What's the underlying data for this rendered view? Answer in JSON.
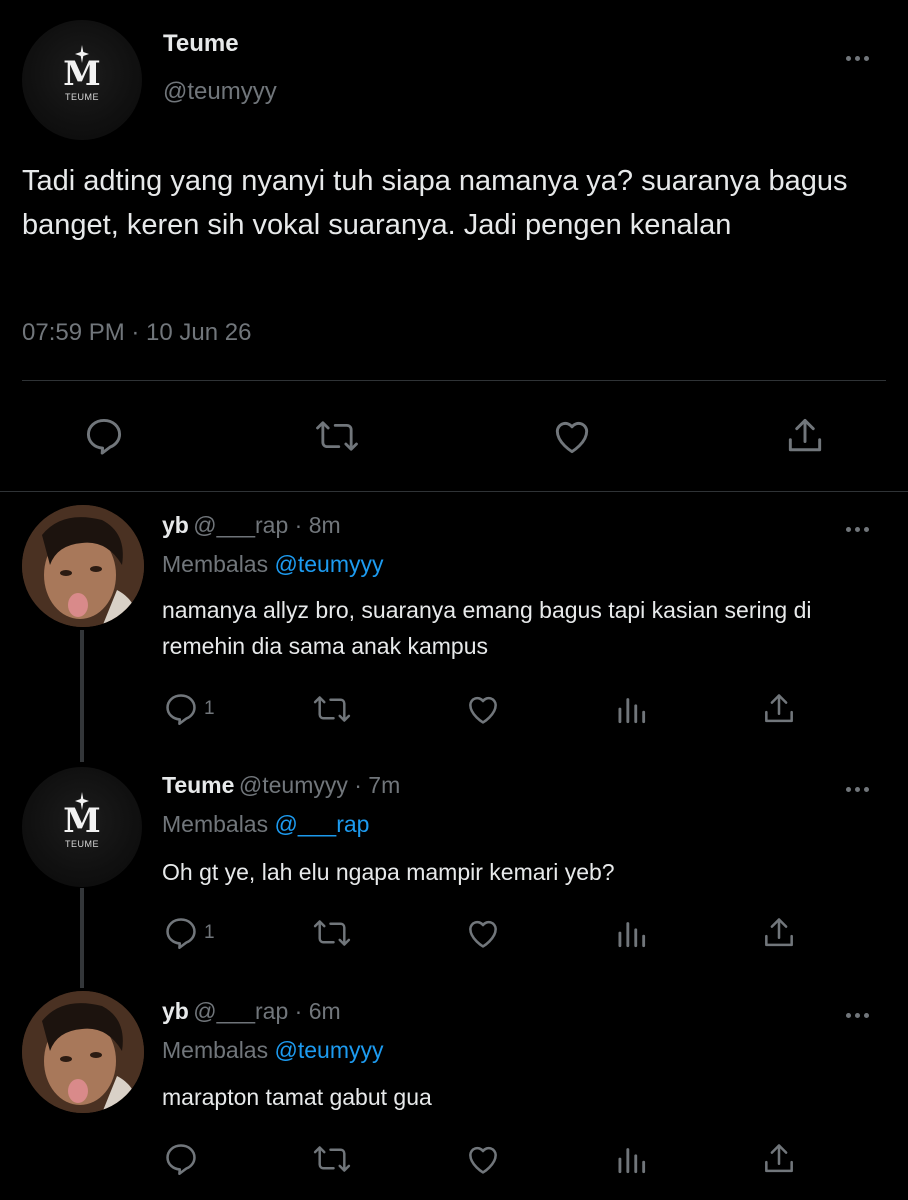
{
  "main_tweet": {
    "author_name": "Teume",
    "author_handle": "@teumyyy",
    "avatar_brand": "TEUME",
    "text": "Tadi adting yang nyanyi tuh siapa namanya ya? suaranya bagus banget, keren sih vokal suaranya. Jadi pengen kenalan",
    "timestamp": "07:59 PM · 10 Jun 26"
  },
  "replies": [
    {
      "author_name": "yb",
      "handle_time": "@___rap · 8m",
      "replying_label": "Membalas",
      "replying_to": "@teumyyy",
      "text": "namanya allyz bro, suaranya emang bagus tapi kasian sering di remehin dia sama anak kampus",
      "reply_count": "1",
      "avatar": "face-photo"
    },
    {
      "author_name": "Teume",
      "handle_time": "@teumyyy · 7m",
      "replying_label": "Membalas",
      "replying_to": "@___rap",
      "text": "Oh gt ye, lah elu ngapa mampir kemari yeb?",
      "reply_count": "1",
      "avatar": "teume-logo",
      "avatar_brand": "TEUME"
    },
    {
      "author_name": "yb",
      "handle_time": "@___rap · 6m",
      "replying_label": "Membalas",
      "replying_to": "@teumyyy",
      "text": "marapton tamat gabut gua",
      "reply_count": "",
      "avatar": "face-photo"
    }
  ],
  "colors": {
    "background": "#000000",
    "text": "#e7e9ea",
    "muted": "#71767b",
    "link": "#1d9bf0",
    "divider": "#2f3336"
  },
  "icons": [
    "reply-icon",
    "retweet-icon",
    "like-icon",
    "views-icon",
    "share-icon",
    "more-icon"
  ]
}
